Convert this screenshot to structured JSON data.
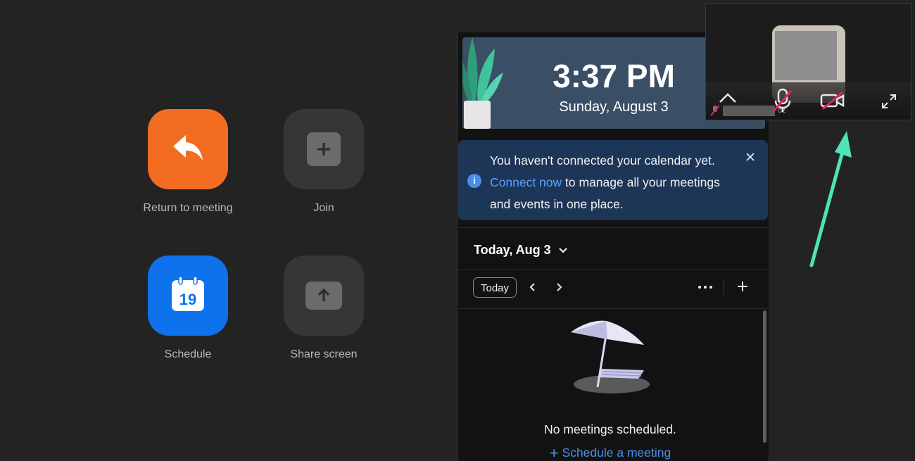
{
  "home": {
    "tiles": [
      {
        "label": "Return to meeting"
      },
      {
        "label": "Join"
      },
      {
        "label": "Schedule",
        "calendar_day": "19"
      },
      {
        "label": "Share screen"
      }
    ]
  },
  "clock": {
    "time": "3:37 PM",
    "date": "Sunday, August 3"
  },
  "calendar_notice": {
    "text_before": "You haven't connected your calendar yet.",
    "link": "Connect now",
    "text_after": "to manage all your meetings and events in one place."
  },
  "calendar": {
    "title": "Today, Aug 3",
    "today_button": "Today",
    "empty_message": "No meetings scheduled.",
    "schedule_link": "Schedule a meeting"
  },
  "video_pip": {
    "name_tail": "dz"
  },
  "colors": {
    "accent_orange": "#f26d21",
    "accent_blue": "#0e72ed",
    "link": "#5aa0ff",
    "arrow": "#4fe3b8"
  }
}
